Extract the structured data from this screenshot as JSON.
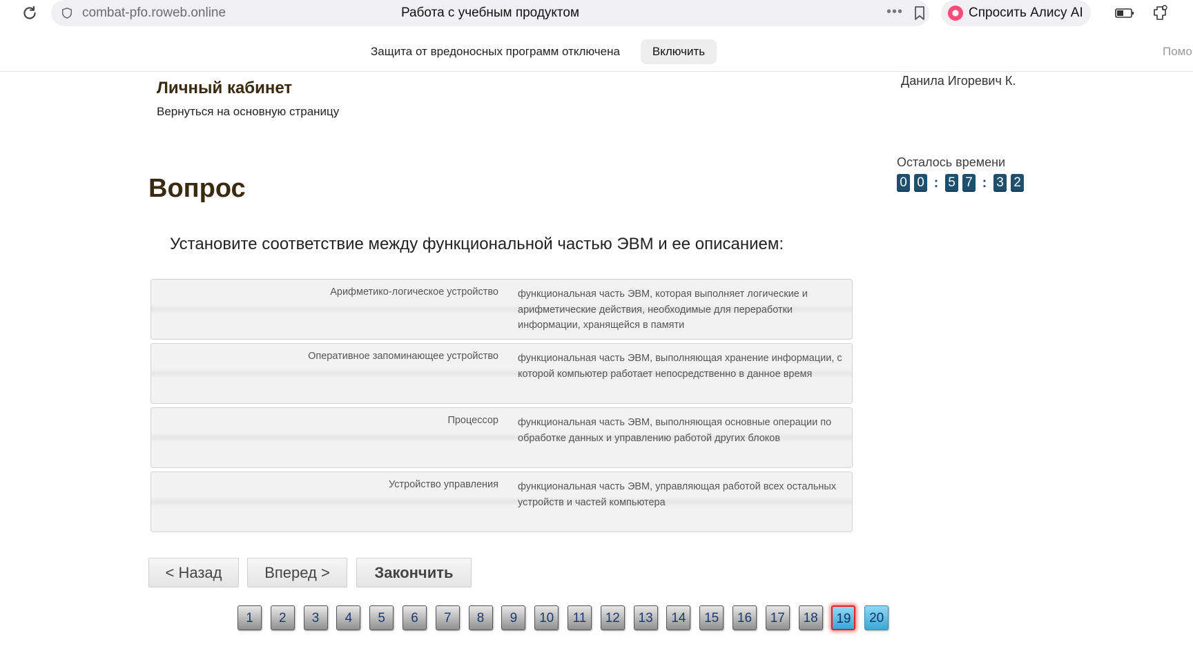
{
  "browser": {
    "url": "combat-pfo.roweb.online",
    "title": "Работа с учебным продуктом",
    "more_icon": "more-horizontal-icon",
    "alice_label": "Спросить Алису AI"
  },
  "notification": {
    "text": "Защита от вредоносных программ отключена",
    "button": "Включить",
    "help": "Помощь"
  },
  "header": {
    "title": "Личный кабинет",
    "back_link": "Вернуться на основную страницу",
    "user_name": "Данила Игоревич К."
  },
  "timer": {
    "label": "Осталось времени",
    "digits": [
      "0",
      "0",
      "5",
      "7",
      "3",
      "2"
    ]
  },
  "question": {
    "heading": "Вопрос",
    "text": "Установите соответствие между функциональной частью ЭВМ и ее описанием:",
    "rows": [
      {
        "term": "Арифметико-логическое устройство",
        "desc": "функциональная часть ЭВМ, которая выполняет логические и арифметические действия, необходимые для переработки информации, хранящейся в памяти"
      },
      {
        "term": "Оперативное запоминающее устройство",
        "desc": "функциональная часть ЭВМ, выполняющая хранение информации, с которой компьютер работает непосредственно в данное время"
      },
      {
        "term": "Процессор",
        "desc": "функциональная часть ЭВМ, выполняющая основные операции по обработке данных и управлению работой других блоков"
      },
      {
        "term": "Устройство управления",
        "desc": "функциональная часть ЭВМ, управляющая работой всех остальных устройств и частей компьютера"
      }
    ]
  },
  "nav": {
    "back": "< Назад",
    "next": "Вперед >",
    "finish": "Закончить"
  },
  "pages": {
    "items": [
      "1",
      "2",
      "3",
      "4",
      "5",
      "6",
      "7",
      "8",
      "9",
      "10",
      "11",
      "12",
      "13",
      "14",
      "15",
      "16",
      "17",
      "18",
      "19",
      "20"
    ],
    "current": "19"
  }
}
